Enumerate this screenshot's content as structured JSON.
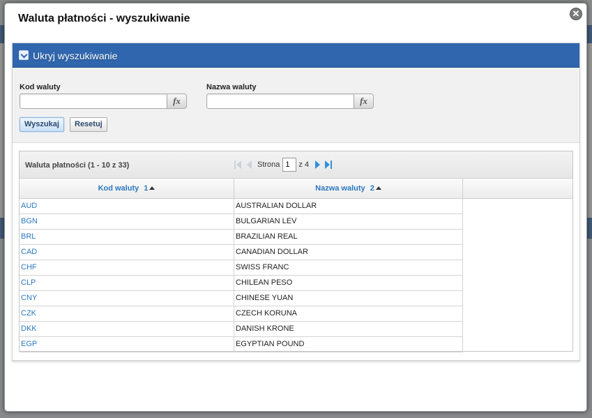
{
  "dialog": {
    "title": "Waluta płatności - wyszukiwanie",
    "close_icon": "close-icon"
  },
  "search_panel": {
    "toggle_label": "Ukryj wyszukiwanie",
    "fields": {
      "code_label": "Kod waluty",
      "code_value": "",
      "name_label": "Nazwa waluty",
      "name_value": "",
      "fx_label": "fx"
    },
    "buttons": {
      "search": "Wyszukaj",
      "reset": "Resetuj"
    }
  },
  "grid": {
    "caption": "Waluta płatności (1 - 10 z 33)",
    "pager": {
      "page_label": "Strona",
      "current_page": "1",
      "of_label": "z 4"
    },
    "columns": [
      {
        "label": "Kod waluty",
        "sort_index": "1"
      },
      {
        "label": "Nazwa waluty",
        "sort_index": "2"
      }
    ],
    "rows": [
      {
        "code": "AUD",
        "name": "AUSTRALIAN DOLLAR"
      },
      {
        "code": "BGN",
        "name": "BULGARIAN LEV"
      },
      {
        "code": "BRL",
        "name": "BRAZILIAN REAL"
      },
      {
        "code": "CAD",
        "name": "CANADIAN DOLLAR"
      },
      {
        "code": "CHF",
        "name": "SWISS FRANC"
      },
      {
        "code": "CLP",
        "name": "CHILEAN PESO"
      },
      {
        "code": "CNY",
        "name": "CHINESE YUAN"
      },
      {
        "code": "CZK",
        "name": "CZECH KORUNA"
      },
      {
        "code": "DKK",
        "name": "DANISH KRONE"
      },
      {
        "code": "EGP",
        "name": "EGYPTIAN POUND"
      }
    ]
  },
  "colors": {
    "header_blue": "#2f66ae",
    "link_blue": "#2a78c0"
  }
}
